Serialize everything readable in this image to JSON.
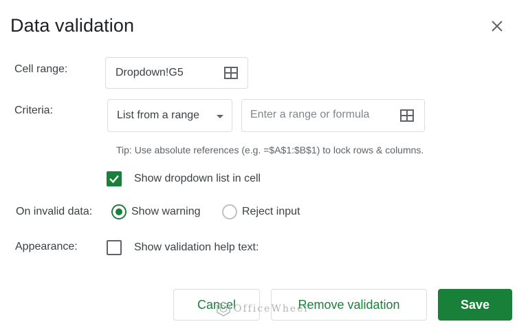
{
  "dialog": {
    "title": "Data validation",
    "close_icon": "close-icon"
  },
  "cell_range": {
    "label": "Cell range:",
    "value": "Dropdown!G5",
    "icon": "grid-icon"
  },
  "criteria": {
    "label": "Criteria:",
    "type_selected": "List from a range",
    "range_placeholder": "Enter a range or formula",
    "icon": "grid-icon",
    "tip": "Tip: Use absolute references (e.g. =$A$1:$B$1) to lock rows & columns."
  },
  "show_dropdown": {
    "label": "Show dropdown list in cell",
    "checked": true
  },
  "invalid_data": {
    "label": "On invalid data:",
    "options": [
      {
        "label": "Show warning",
        "selected": true
      },
      {
        "label": "Reject input",
        "selected": false
      }
    ]
  },
  "appearance": {
    "label": "Appearance:",
    "help_text_label": "Show validation help text:",
    "checked": false
  },
  "buttons": {
    "cancel": "Cancel",
    "remove": "Remove validation",
    "save": "Save"
  },
  "watermark": "OfficeWheel",
  "colors": {
    "accent": "#188038",
    "border": "#dadce0",
    "text": "#3c4043"
  }
}
